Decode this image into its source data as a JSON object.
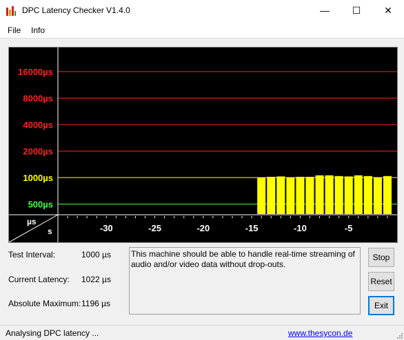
{
  "window": {
    "title": "DPC Latency Checker V1.4.0",
    "minimize_glyph": "—",
    "maximize_glyph": "☐",
    "close_glyph": "✕"
  },
  "menu": {
    "file": "File",
    "info": "Info"
  },
  "chart_data": {
    "type": "bar",
    "y_scale": "log2",
    "y_tick_labels": [
      "16000µs",
      "8000µs",
      "4000µs",
      "2000µs",
      "1000µs",
      "500µs"
    ],
    "y_tick_values": [
      16000,
      8000,
      4000,
      2000,
      1000,
      500
    ],
    "y_tick_colors": [
      "#ff2020",
      "#ff2020",
      "#ff2020",
      "#ff2020",
      "#ffff00",
      "#40ff40"
    ],
    "corner_top": "µs",
    "corner_bottom": "s",
    "x_tick_labels": [
      "-30",
      "-25",
      "-20",
      "-15",
      "-10",
      "-5"
    ],
    "x_tick_values": [
      -30,
      -25,
      -20,
      -15,
      -10,
      -5
    ],
    "xlim": [
      -35,
      0
    ],
    "x_seconds": [
      -14,
      -13,
      -12,
      -11,
      -10,
      -9,
      -8,
      -7,
      -6,
      -5,
      -4,
      -3,
      -2,
      -1
    ],
    "values_us": [
      1000,
      1020,
      1030,
      1010,
      1020,
      1020,
      1060,
      1060,
      1040,
      1030,
      1060,
      1040,
      1010,
      1040
    ],
    "bar_color": "#ffff00",
    "background": "#000000"
  },
  "info": {
    "test_interval_label": "Test Interval:",
    "test_interval_value": "1000 µs",
    "current_latency_label": "Current Latency:",
    "current_latency_value": "1022 µs",
    "absolute_max_label": "Absolute Maximum:",
    "absolute_max_value": "1196 µs"
  },
  "message": "This machine should be able to handle real-time streaming of audio and/or video data without drop-outs.",
  "buttons": {
    "stop": "Stop",
    "reset": "Reset",
    "exit": "Exit"
  },
  "status": {
    "text": "Analysing DPC latency ...",
    "link": "www.thesycon.de"
  }
}
